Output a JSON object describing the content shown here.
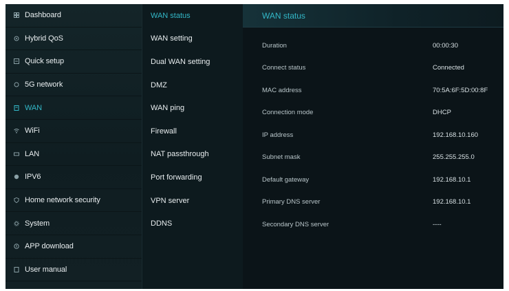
{
  "sidebar": {
    "items": [
      {
        "label": "Dashboard",
        "icon": "dashboard-icon",
        "active": false
      },
      {
        "label": "Hybrid QoS",
        "icon": "qos-icon",
        "active": false
      },
      {
        "label": "Quick setup",
        "icon": "quick-setup-icon",
        "active": false
      },
      {
        "label": "5G network",
        "icon": "network-icon",
        "active": false
      },
      {
        "label": "WAN",
        "icon": "wan-icon",
        "active": true
      },
      {
        "label": "WiFi",
        "icon": "wifi-icon",
        "active": false
      },
      {
        "label": "LAN",
        "icon": "lan-icon",
        "active": false
      },
      {
        "label": "IPV6",
        "icon": "ipv6-icon",
        "active": false
      },
      {
        "label": "Home network security",
        "icon": "shield-icon",
        "active": false
      },
      {
        "label": "System",
        "icon": "system-icon",
        "active": false
      },
      {
        "label": "APP download",
        "icon": "download-icon",
        "active": false
      },
      {
        "label": "User manual",
        "icon": "manual-icon",
        "active": false
      }
    ]
  },
  "submenu": {
    "items": [
      {
        "label": "WAN status",
        "active": true
      },
      {
        "label": "WAN setting",
        "active": false
      },
      {
        "label": "Dual WAN setting",
        "active": false
      },
      {
        "label": "DMZ",
        "active": false
      },
      {
        "label": "WAN ping",
        "active": false
      },
      {
        "label": "Firewall",
        "active": false
      },
      {
        "label": "NAT passthrough",
        "active": false
      },
      {
        "label": "Port forwarding",
        "active": false
      },
      {
        "label": "VPN server",
        "active": false
      },
      {
        "label": "DDNS",
        "active": false
      }
    ]
  },
  "main": {
    "title": "WAN status",
    "rows": [
      {
        "label": "Duration",
        "value": "00:00:30"
      },
      {
        "label": "Connect status",
        "value": "Connected"
      },
      {
        "label": "MAC address",
        "value": "70:5A:6F:5D:00:8F"
      },
      {
        "label": "Connection mode",
        "value": "DHCP"
      },
      {
        "label": "IP address",
        "value": "192.168.10.160"
      },
      {
        "label": "Subnet mask",
        "value": "255.255.255.0"
      },
      {
        "label": "Default gateway",
        "value": "192.168.10.1"
      },
      {
        "label": "Primary DNS server",
        "value": "192.168.10.1"
      },
      {
        "label": "Secondary DNS server",
        "value": "----"
      }
    ]
  },
  "colors": {
    "accent": "#33b8c8",
    "background": "#0b1418",
    "sidebar": "#142529"
  }
}
